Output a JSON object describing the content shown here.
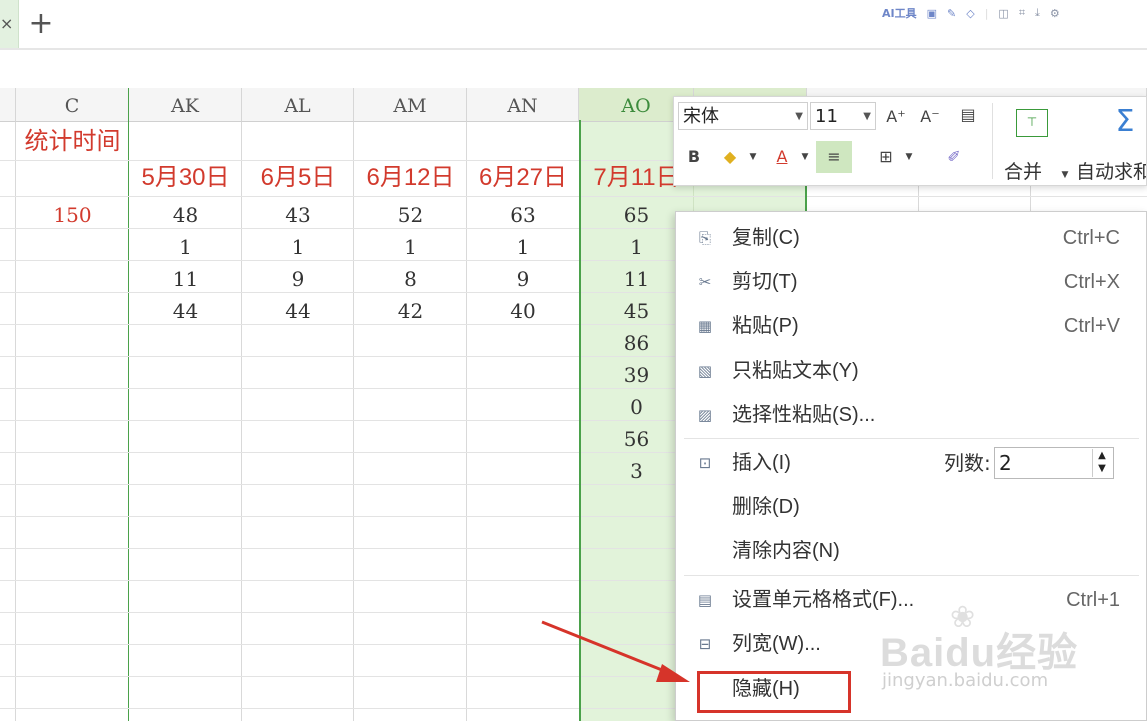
{
  "topbar": {
    "tab_close": "×",
    "add_tab": "+",
    "ai_tool": "AI工具"
  },
  "columns": [
    {
      "label": "C"
    },
    {
      "label": "AK"
    },
    {
      "label": "AL"
    },
    {
      "label": "AM"
    },
    {
      "label": "AN"
    },
    {
      "label": "AO"
    }
  ],
  "sheet": {
    "c_title": "统计时间",
    "c_value": "150",
    "date_headers": [
      "5月30日",
      "6月5日",
      "6月12日",
      "6月27日",
      "7月11日"
    ],
    "rows": [
      [
        "48",
        "43",
        "52",
        "63",
        "65"
      ],
      [
        "1",
        "1",
        "1",
        "1",
        "1"
      ],
      [
        "11",
        "9",
        "8",
        "9",
        "11"
      ],
      [
        "44",
        "44",
        "42",
        "40",
        "45"
      ]
    ],
    "ao_extra": [
      "86",
      "39",
      "0",
      "56",
      "3"
    ]
  },
  "mini_toolbar": {
    "font_name": "宋体",
    "font_size": "11",
    "bold": "B",
    "font_color_letter": "A",
    "merge": "合并",
    "autosum": "自动求和",
    "grow_font": "A⁺",
    "shrink_font": "A⁻"
  },
  "context_menu": {
    "items": [
      {
        "label": "复制(C)",
        "shortcut": "Ctrl+C",
        "icon": "copy-icon"
      },
      {
        "label": "剪切(T)",
        "shortcut": "Ctrl+X",
        "icon": "scissors-icon"
      },
      {
        "label": "粘贴(P)",
        "shortcut": "Ctrl+V",
        "icon": "paste-icon"
      },
      {
        "label": "只粘贴文本(Y)",
        "shortcut": "",
        "icon": "paste-text-icon"
      },
      {
        "label": "选择性粘贴(S)...",
        "shortcut": "",
        "icon": "paste-special-icon"
      },
      {
        "label": "插入(I)",
        "shortcut": "",
        "icon": "insert-icon"
      },
      {
        "label": "删除(D)",
        "shortcut": "",
        "icon": ""
      },
      {
        "label": "清除内容(N)",
        "shortcut": "",
        "icon": ""
      },
      {
        "label": "设置单元格格式(F)...",
        "shortcut": "Ctrl+1",
        "icon": "format-cells-icon"
      },
      {
        "label": "列宽(W)...",
        "shortcut": "",
        "icon": "column-width-icon"
      },
      {
        "label": "隐藏(H)",
        "shortcut": "",
        "icon": ""
      }
    ],
    "column_count_label": "列数:",
    "column_count_value": "2"
  },
  "watermark": {
    "brand": "Baidu经验",
    "url": "jingyan.baidu.com"
  },
  "colors": {
    "accent_green": "#4aa14a",
    "selected_fill": "#e2f3da",
    "red_text": "#d23a2d",
    "highlight_box": "#d6342a"
  }
}
